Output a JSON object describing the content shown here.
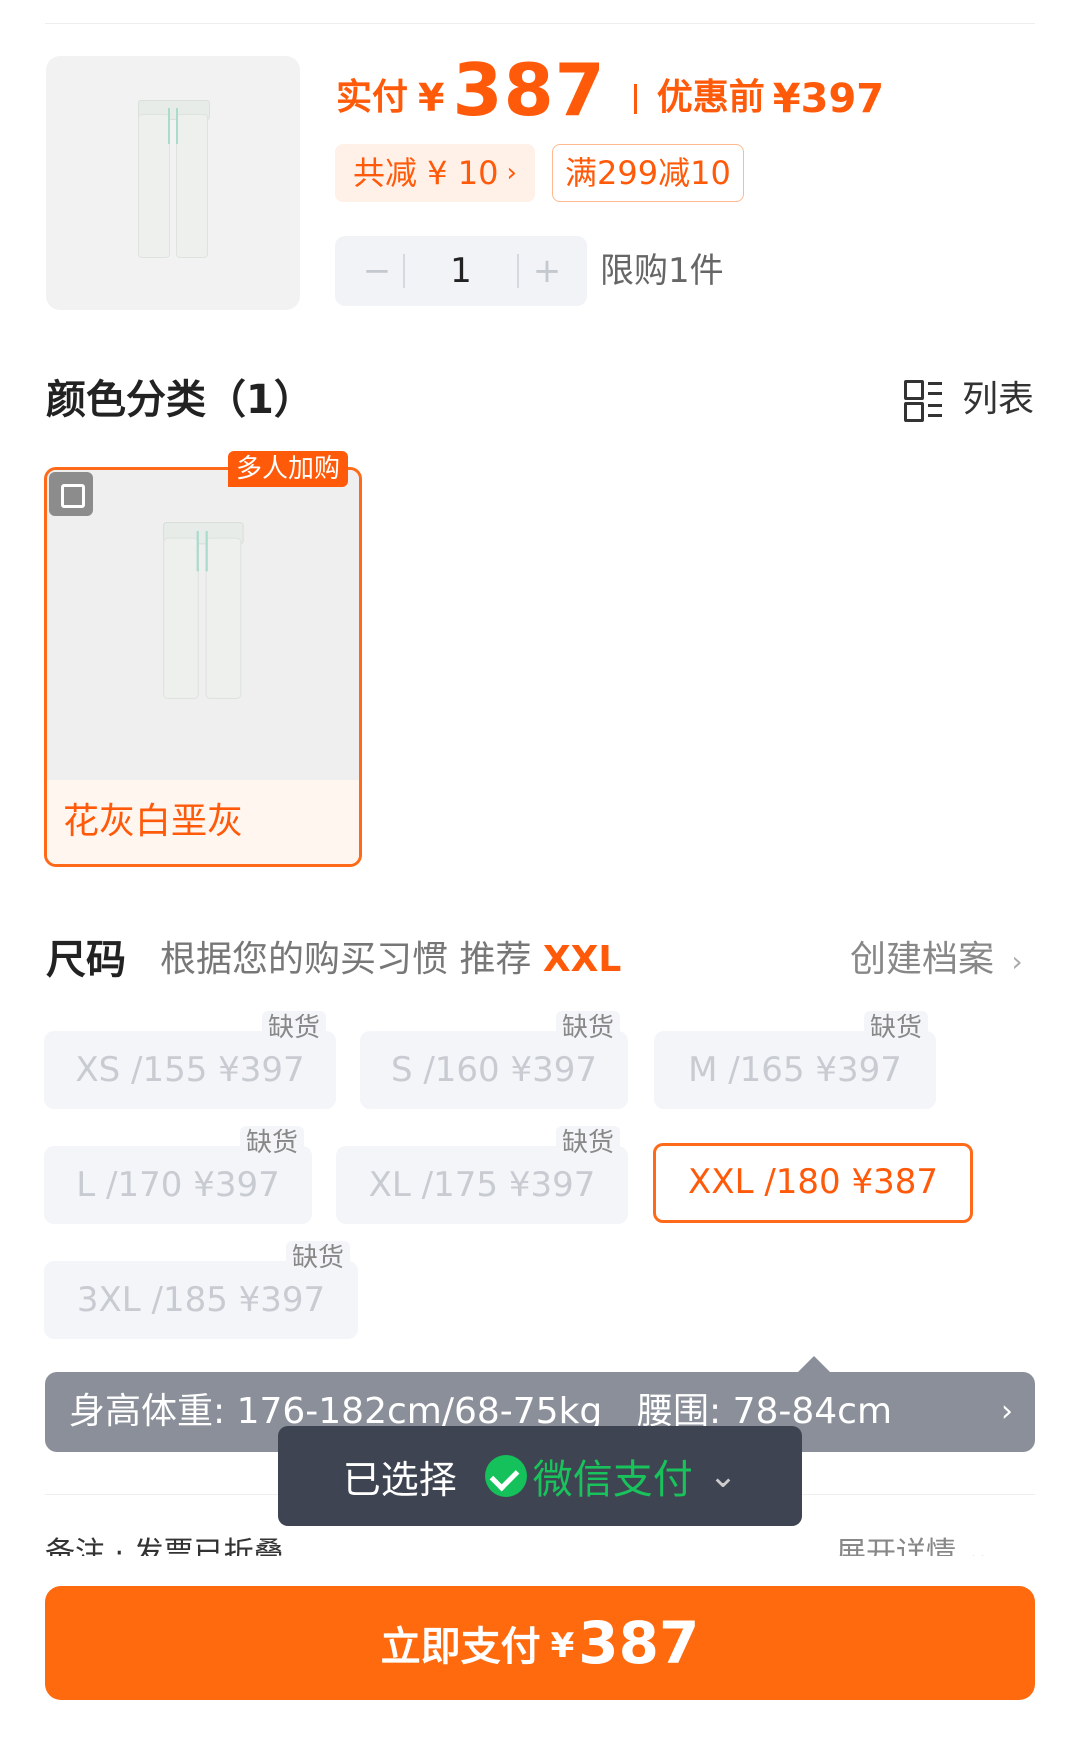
{
  "product": {
    "paid_label": "实付",
    "currency": "¥",
    "paid_value": "387",
    "pre_label": "优惠前",
    "pre_value": "¥397",
    "discount_tag": "共减 ¥ 10",
    "discount_chevron": "›",
    "coupon_tag": "满299减10",
    "quantity": "1",
    "minus_label": "−",
    "plus_label": "+",
    "limit_text": "限购1件"
  },
  "color_section": {
    "title": "颜色分类（1）",
    "view_toggle_label": "列表",
    "badge": "多人加购",
    "options": [
      {
        "label": "花灰白垩灰",
        "selected": true
      }
    ]
  },
  "size_section": {
    "title": "尺码",
    "hint_prefix": "根据您的购买习惯 推荐",
    "recommended": "XXL",
    "profile_link": "创建档案",
    "profile_chevron": "›",
    "out_of_stock_label": "缺货",
    "sizes": [
      {
        "label": "XS /155  ¥397",
        "out_of_stock": true
      },
      {
        "label": "S /160  ¥397",
        "out_of_stock": true
      },
      {
        "label": "M /165  ¥397",
        "out_of_stock": true
      },
      {
        "label": "L /170  ¥397",
        "out_of_stock": true
      },
      {
        "label": "XL /175  ¥397",
        "out_of_stock": true
      },
      {
        "label": "XXL /180  ¥387",
        "out_of_stock": false,
        "selected": true
      },
      {
        "label": "3XL /185  ¥397",
        "out_of_stock": true
      }
    ]
  },
  "fit_info": {
    "height_weight": "身高体重: 176-182cm/68-75kg",
    "waist": "腰围: 78-84cm",
    "chevron": "›"
  },
  "remark": {
    "left_text": "备注 · 发票已折叠",
    "right_text": "展开详情 ⌄"
  },
  "toast": {
    "prefix": "已选择",
    "payment_method": "微信支付",
    "chevron": "⌄"
  },
  "pay_button": {
    "label": "立即支付",
    "currency": "¥",
    "amount": "387"
  },
  "colors": {
    "accent": "#ff5a0a",
    "pay_button": "#ff6a0f",
    "wechat_green": "#19c35b"
  }
}
